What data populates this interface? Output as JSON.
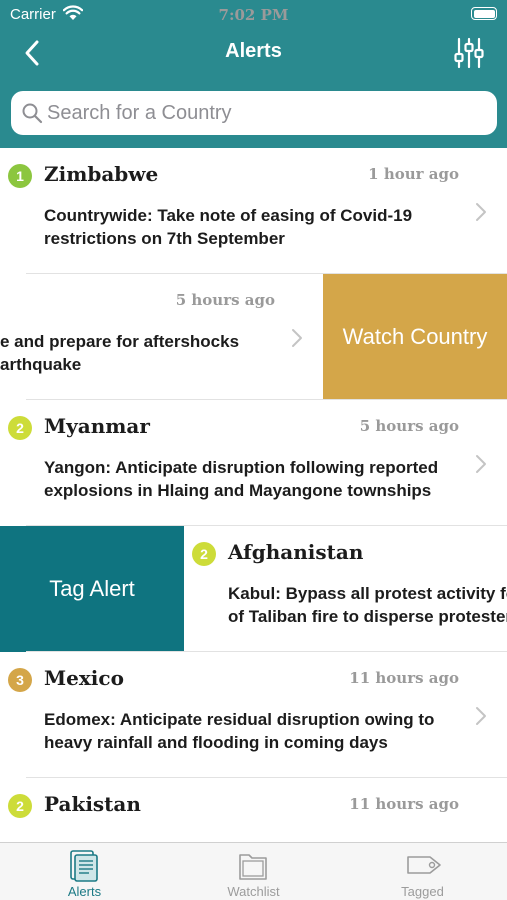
{
  "status_bar": {
    "carrier": "Carrier",
    "time": "7:02 PM"
  },
  "navbar": {
    "title": "Alerts",
    "back_icon": "chevron-left-icon",
    "filter_icon": "sliders-icon"
  },
  "search": {
    "placeholder": "Search for a Country",
    "value": ""
  },
  "colors": {
    "header": "#2a8a8f",
    "badge_1": "#8cc63f",
    "badge_2": "#cddc39",
    "badge_3": "#d4a649",
    "watch_action": "#d4a649",
    "tag_action": "#0f7480",
    "tab_active": "#1c7a85"
  },
  "alerts": [
    {
      "level": "1",
      "country": "Zimbabwe",
      "time": "1 hour ago",
      "summary": "Countrywide: Take note of easing of Covid-19 restrictions on 7th September"
    },
    {
      "level": "",
      "country": "",
      "time": "5 hours ago",
      "summary": "e and prepare for aftershocks arthquake",
      "line1": "e and prepare for aftershocks",
      "line2": "arthquake"
    },
    {
      "level": "2",
      "country": "Myanmar",
      "time": "5 hours ago",
      "summary": "Yangon: Anticipate disruption following reported explosions in Hlaing and Mayangone townships"
    },
    {
      "level": "2",
      "country": "Afghanistan",
      "time": "",
      "summary": "Kabul: Bypass all protest activity fo of Taliban fire to disperse protester",
      "line1": "Kabul: Bypass all protest activity fo",
      "line2": "of Taliban fire to disperse protester"
    },
    {
      "level": "3",
      "country": "Mexico",
      "time": "11 hours ago",
      "summary": "Edomex: Anticipate residual disruption owing to heavy rainfall and flooding in coming days"
    },
    {
      "level": "2",
      "country": "Pakistan",
      "time": "11 hours ago",
      "summary": ""
    }
  ],
  "swipe_actions": {
    "watch": "Watch Country",
    "tag": "Tag Alert"
  },
  "tabs": [
    {
      "label": "Alerts",
      "icon": "document-icon",
      "active": true
    },
    {
      "label": "Watchlist",
      "icon": "folder-icon",
      "active": false
    },
    {
      "label": "Tagged",
      "icon": "tag-icon",
      "active": false
    }
  ]
}
